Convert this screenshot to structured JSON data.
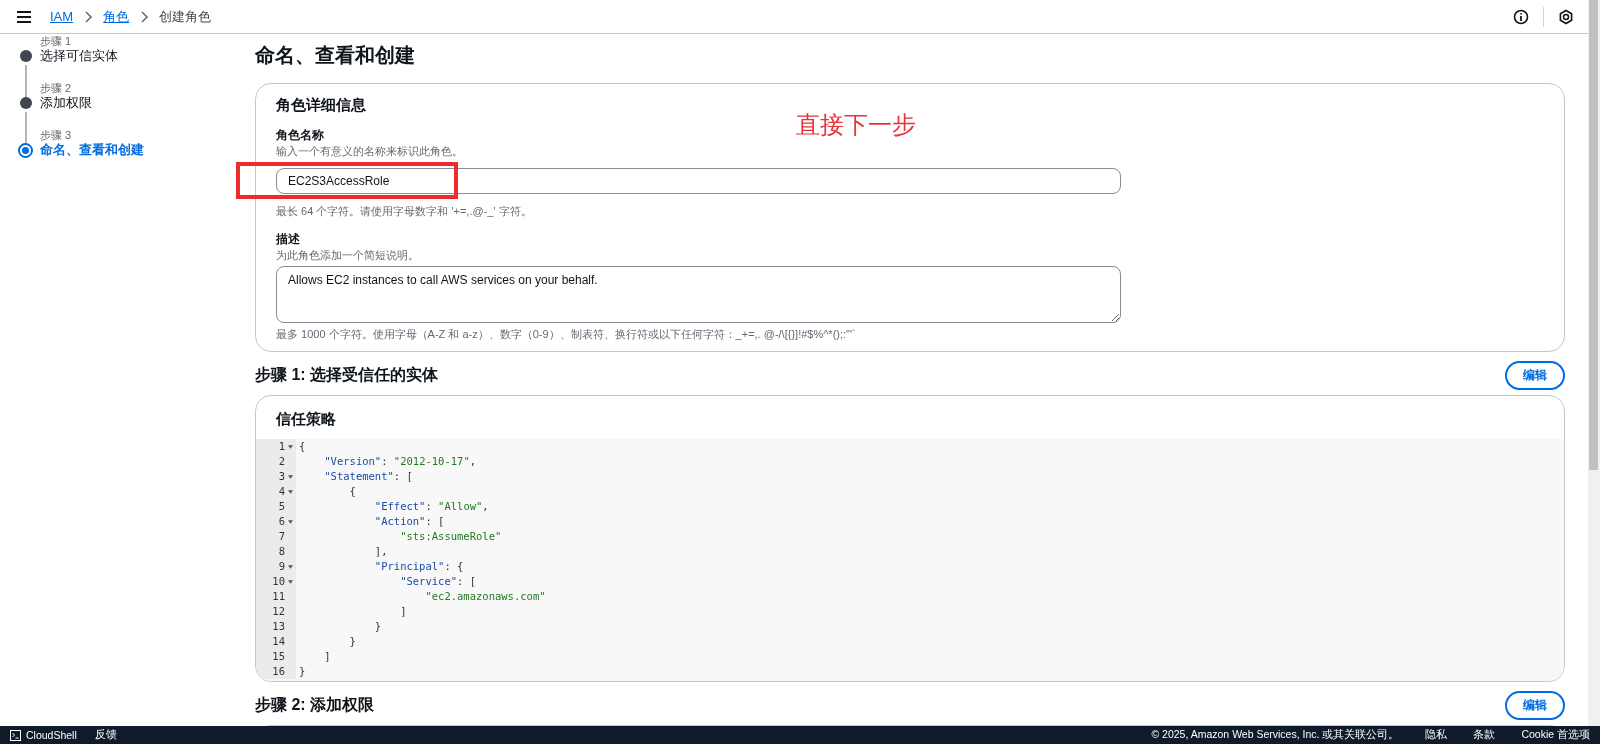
{
  "breadcrumbs": [
    {
      "label": "IAM",
      "link": true
    },
    {
      "label": "角色",
      "link": true
    },
    {
      "label": "创建角色",
      "link": false
    }
  ],
  "steps": [
    {
      "label": "步骤 1",
      "title": "选择可信实体",
      "selected": false
    },
    {
      "label": "步骤 2",
      "title": "添加权限",
      "selected": false
    },
    {
      "label": "步骤 3",
      "title": "命名、查看和创建",
      "selected": true
    }
  ],
  "page_title": "命名、查看和创建",
  "details": {
    "title": "角色详细信息",
    "name": {
      "label": "角色名称",
      "hint": "输入一个有意义的名称来标识此角色。",
      "value": "EC2S3AccessRole",
      "constraint": "最长 64 个字符。请使用字母数字和 '+=,.@-_' 字符。"
    },
    "description": {
      "label": "描述",
      "hint": "为此角色添加一个简短说明。",
      "value": "Allows EC2 instances to call AWS services on your behalf.",
      "constraint": "最多 1000 个字符。使用字母（A-Z 和 a-z）、数字（0-9）、制表符、换行符或以下任何字符：_+=,. @-/\\[{}]!#$%^*();:\"'`"
    }
  },
  "annotation": {
    "text": "直接下一步"
  },
  "step1": {
    "heading": "步骤 1: 选择受信任的实体",
    "edit": "编辑",
    "card_title": "信任策略",
    "code": [
      {
        "number": "1",
        "text": "{",
        "foldable": true
      },
      {
        "number": "2",
        "text": "    \"Version\": \"2012-10-17\",",
        "foldable": false
      },
      {
        "number": "3",
        "text": "    \"Statement\": [",
        "foldable": true
      },
      {
        "number": "4",
        "text": "        {",
        "foldable": true
      },
      {
        "number": "5",
        "text": "            \"Effect\": \"Allow\",",
        "foldable": false
      },
      {
        "number": "6",
        "text": "            \"Action\": [",
        "foldable": true
      },
      {
        "number": "7",
        "text": "                \"sts:AssumeRole\"",
        "foldable": false
      },
      {
        "number": "8",
        "text": "            ],",
        "foldable": false
      },
      {
        "number": "9",
        "text": "            \"Principal\": {",
        "foldable": true
      },
      {
        "number": "10",
        "text": "                \"Service\": [",
        "foldable": true
      },
      {
        "number": "11",
        "text": "                    \"ec2.amazonaws.com\"",
        "foldable": false
      },
      {
        "number": "12",
        "text": "                ]",
        "foldable": false
      },
      {
        "number": "13",
        "text": "            }",
        "foldable": false
      },
      {
        "number": "14",
        "text": "        }",
        "foldable": false
      },
      {
        "number": "15",
        "text": "    ]",
        "foldable": false
      },
      {
        "number": "16",
        "text": "}",
        "foldable": false
      }
    ]
  },
  "step2": {
    "heading": "步骤 2: 添加权限",
    "edit": "编辑"
  },
  "footer": {
    "cloudshell": "CloudShell",
    "feedback": "反馈",
    "copyright": "© 2025, Amazon Web Services, Inc. 或其关联公司。",
    "links": [
      "隐私",
      "条款",
      "Cookie 首选项"
    ]
  }
}
